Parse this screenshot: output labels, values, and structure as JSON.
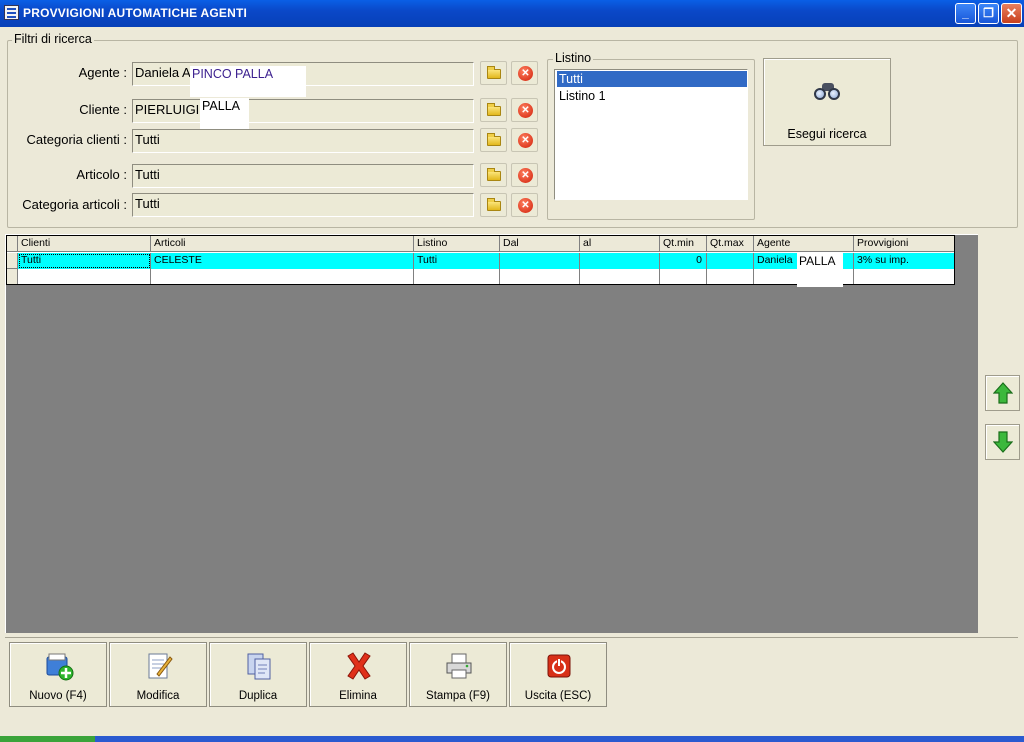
{
  "window": {
    "title": "PROVVIGIONI AUTOMATICHE AGENTI",
    "minimize_glyph": "_",
    "restore_glyph": "❐",
    "close_glyph": "✕"
  },
  "filters": {
    "group_title": "Filtri di ricerca",
    "agente": {
      "label": "Agente :",
      "value": "Daniela A",
      "overlay": "PINCO PALLA"
    },
    "cliente": {
      "label": "Cliente :",
      "value": "PIERLUIGI",
      "overlay": "PALLA"
    },
    "categoria_clienti": {
      "label": "Categoria clienti :",
      "value": "Tutti"
    },
    "articolo": {
      "label": "Articolo :",
      "value": "Tutti"
    },
    "categoria_articoli": {
      "label": "Categoria articoli :",
      "value": "Tutti"
    },
    "clear_glyph": "✕"
  },
  "listino": {
    "title": "Listino",
    "items": [
      "Tutti",
      "Listino 1"
    ],
    "selected": "Tutti"
  },
  "search_button": {
    "label": "Esegui ricerca",
    "icon": "binoculars-icon"
  },
  "grid": {
    "columns": [
      "Clienti",
      "Articoli",
      "Listino",
      "Dal",
      "al",
      "Qt.min",
      "Qt.max",
      "Agente",
      "Provvigioni"
    ],
    "rows": [
      [
        "Tutti",
        "CELESTE",
        "Tutti",
        "",
        "",
        "0",
        "",
        "Daniela",
        "3% su imp."
      ]
    ],
    "agent_overlay": "PALLA",
    "row_highlight": "#00ffff"
  },
  "toolbar": {
    "nuovo": "Nuovo (F4)",
    "modifica": "Modifica",
    "duplica": "Duplica",
    "elimina": "Elimina",
    "stampa": "Stampa (F9)",
    "uscita": "Uscita (ESC)"
  }
}
